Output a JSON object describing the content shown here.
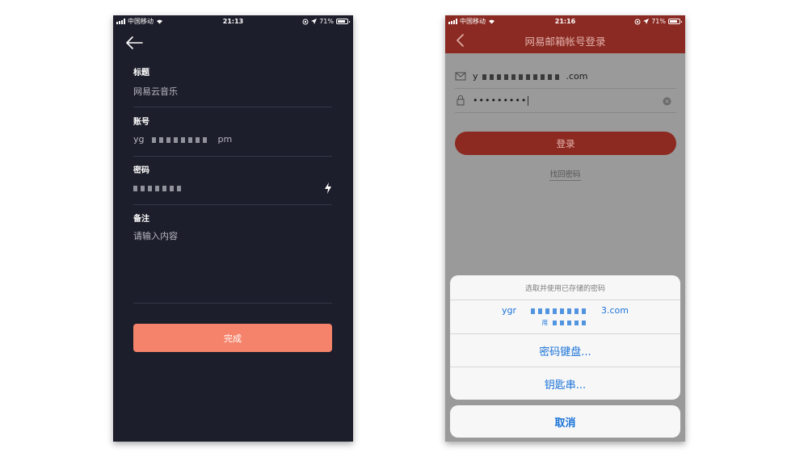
{
  "left_phone": {
    "status": {
      "carrier": "中国移动",
      "time": "21:13",
      "battery": "71%"
    },
    "fields": [
      {
        "label": "标题",
        "value": "网易云音乐"
      },
      {
        "label": "账号",
        "value_prefix": "yg",
        "value_suffix": "pm"
      },
      {
        "label": "密码"
      },
      {
        "label": "备注",
        "placeholder": "请输入内容"
      }
    ],
    "done_label": "完成"
  },
  "right_phone": {
    "status": {
      "carrier": "中国移动",
      "time": "21:16",
      "battery": "71%"
    },
    "nav_title": "网易邮箱帐号登录",
    "email_prefix": "y",
    "email_suffix": ".com",
    "password_dots": "•••••••••",
    "login_label": "登录",
    "forgot_label": "找回密码",
    "sheet": {
      "header": "选取并使用已存储的密码",
      "account_prefix": "ygr",
      "account_suffix": "3.com",
      "account_user_prefix": "用",
      "keyboard_label": "密码键盘...",
      "keychain_label": "钥匙串...",
      "cancel_label": "取消"
    }
  },
  "colors": {
    "left_background": "#1d1e2b",
    "done_button": "#f5826a",
    "nav_red": "#8a2a22",
    "ios_blue": "#1a73d9"
  },
  "icons": [
    "back-arrow-icon",
    "flash-icon",
    "mail-icon",
    "lock-icon",
    "clear-icon",
    "wifi-icon",
    "location-icon"
  ]
}
